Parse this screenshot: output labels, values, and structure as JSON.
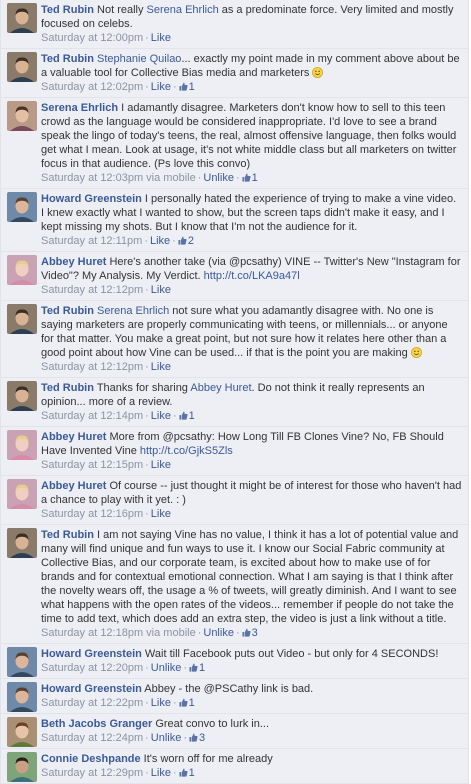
{
  "colors": {
    "link": "#3b5998",
    "meta": "#8b93a4",
    "background": "#edeff4",
    "divider": "#e2e4ea"
  },
  "icons": {
    "like": "thumbs-up-icon",
    "smiley": "smiley-emoticon-icon",
    "avatar": "profile-photo"
  },
  "labels": {
    "like": "Like",
    "unlike": "Unlike",
    "sep": " · "
  },
  "comments": [
    {
      "author": "Ted Rubin",
      "parts": [
        " Not really ",
        {
          "link": "Serena Ehrlich"
        },
        " as a predominate force. Very limited and mostly focused on celebs."
      ],
      "time": "Saturday at 12:00pm",
      "via": "",
      "action": "Like",
      "likes": ""
    },
    {
      "author": "Ted Rubin",
      "parts": [
        " ",
        {
          "link": "Stephanie Quilao"
        },
        "... exactly my point made in my comment above about be a valuable tool for Collective Bias media and marketers ",
        {
          "emoji": "smile"
        }
      ],
      "time": "Saturday at 12:02pm",
      "via": "",
      "action": "Like",
      "likes": "1"
    },
    {
      "author": "Serena Ehrlich",
      "parts": [
        " I adamantly disagree. Marketers don't know how to sell to this teen crowd as the language would be considered inappropriate. I'd love to see a brand speak the lingo of today's teens, the real, almost offensive language, then folks would get what I mean. Look at usage, it's not white middle class but all marketers on twitter focus in that audience. (Ps love this convo)"
      ],
      "time": "Saturday at 12:03pm",
      "via": "via mobile",
      "action": "Unlike",
      "likes": "1"
    },
    {
      "author": "Howard Greenstein",
      "parts": [
        " I personally hated the experience of trying to make a vine video. I knew exactly what I wanted to show, but the screen taps didn't make it easy, and I kept missing my shots. But I know that I'm not the audience for it."
      ],
      "time": "Saturday at 12:11pm",
      "via": "",
      "action": "Like",
      "likes": "2"
    },
    {
      "author": "Abbey Huret",
      "parts": [
        " Here's another take (via @pcsathy) VINE -- Twitter's New \"Instagram for Video\"? My Analysis. My Verdict. ",
        {
          "link": "http://t.co/LKA9a47l"
        }
      ],
      "time": "Saturday at 12:12pm",
      "via": "",
      "action": "Like",
      "likes": ""
    },
    {
      "author": "Ted Rubin",
      "parts": [
        " ",
        {
          "link": "Serena Ehrlich"
        },
        " not sure what you adamantly disagree with. No one is saying marketers are properly communicating with teens, or millennials... or anyone for that matter. You make a great point, but not sure how it relates here other than a good point about how Vine can be used... if that is the point you are making ",
        {
          "emoji": "smile"
        }
      ],
      "time": "Saturday at 12:12pm",
      "via": "",
      "action": "Like",
      "likes": ""
    },
    {
      "author": "Ted Rubin",
      "parts": [
        " Thanks for sharing ",
        {
          "link": "Abbey Huret"
        },
        ". Do not think it really represents an opinion... more of a review."
      ],
      "time": "Saturday at 12:14pm",
      "via": "",
      "action": "Like",
      "likes": "1"
    },
    {
      "author": "Abbey Huret",
      "parts": [
        " More from @pcsathy: How Long Till FB Clones Vine? No, FB Should Have Invented Vine ",
        {
          "link": "http://t.co/GjkS5Zls"
        }
      ],
      "time": "Saturday at 12:15pm",
      "via": "",
      "action": "Like",
      "likes": ""
    },
    {
      "author": "Abbey Huret",
      "parts": [
        " Of course -- just thought it might be of interest for those who haven't had a chance to play with it yet. : )"
      ],
      "time": "Saturday at 12:16pm",
      "via": "",
      "action": "Like",
      "likes": ""
    },
    {
      "author": "Ted Rubin",
      "parts": [
        " I am not saying Vine has no value, I think it has a lot of potential value and many will find unique and fun ways to use it. I know our Social Fabric community at Collective Bias, and our corporate team, is excited about how to make use of for brands and for contextual emotional connection. What I am saying is that I think after the novelty wears off, the usage a % of tweets, will greatly diminish. And I want to see what happens with the open rates of the videos... remember if people do not take the time to add text, which does add an extra step, the video is just a link without a title."
      ],
      "time": "Saturday at 12:18pm",
      "via": "via mobile",
      "action": "Unlike",
      "likes": "3"
    },
    {
      "author": "Howard Greenstein",
      "parts": [
        " Wait till Facebook puts out Video - but only for 4 SECONDS!"
      ],
      "time": "Saturday at 12:20pm",
      "via": "",
      "action": "Unlike",
      "likes": "1"
    },
    {
      "author": "Howard Greenstein",
      "parts": [
        " Abbey - the @PSCathy link is bad."
      ],
      "time": "Saturday at 12:22pm",
      "via": "",
      "action": "Like",
      "likes": "1"
    },
    {
      "author": "Beth Jacobs Granger",
      "parts": [
        " Great convo to lurk in..."
      ],
      "time": "Saturday at 12:24pm",
      "via": "",
      "action": "Unlike",
      "likes": "3"
    },
    {
      "author": "Connie Deshpande",
      "parts": [
        " It's worn off for me already"
      ],
      "time": "Saturday at 12:29pm",
      "via": "",
      "action": "Like",
      "likes": "1"
    }
  ]
}
